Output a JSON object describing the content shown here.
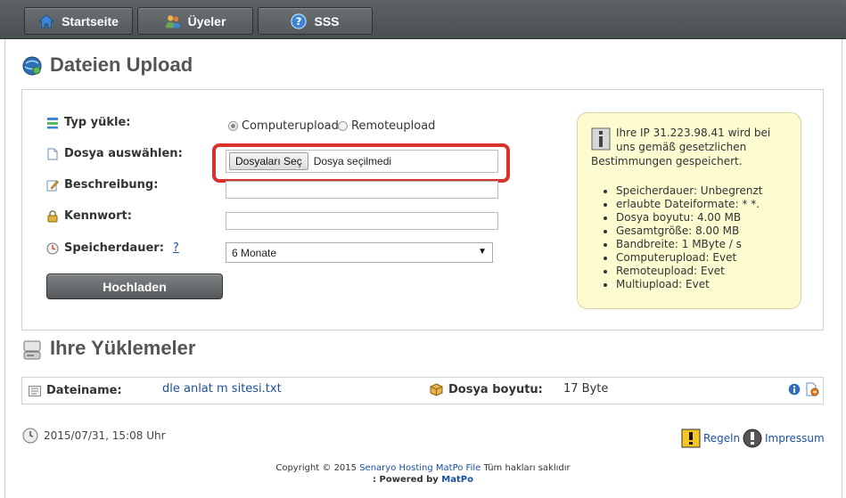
{
  "nav": {
    "items": [
      {
        "label": "Startseite",
        "icon": "home-icon"
      },
      {
        "label": "Üyeler",
        "icon": "users-icon"
      },
      {
        "label": "SSS",
        "icon": "help-icon"
      }
    ]
  },
  "upload_section": {
    "title": "Dateien Upload",
    "type_label": "Typ yükle:",
    "radio_computer": "Computerupload",
    "radio_remote": "Remoteupload",
    "file_label": "Dosya auswählen:",
    "file_button": "Dosyaları Seç",
    "file_status": "Dosya seçilmedi",
    "description_label": "Beschreibung:",
    "password_label": "Kennwort:",
    "storage_label": "Speicherdauer:",
    "storage_help": "?",
    "storage_value": "6 Monate",
    "upload_button": "Hochladen"
  },
  "info": {
    "text": "Ihre IP 31.223.98.41 wird bei uns gemäß gesetzlichen Bestimmungen gespeichert.",
    "items": [
      "Speicherdauer: Unbegrenzt",
      "erlaubte Dateiformate: * *.",
      "Dosya boyutu: 4.00 MB",
      "Gesamtgröße: 8.00 MB",
      "Bandbreite: 1 MByte / s",
      "Computerupload: Evet",
      "Remoteupload: Evet",
      "Multiupload: Evet"
    ]
  },
  "uploads_section": {
    "title": "Ihre Yüklemeler",
    "filename_label": "Dateiname:",
    "filename_value": "dle anlat m sitesi.txt",
    "size_label": "Dosya boyutu:",
    "size_value": "17 Byte"
  },
  "footer": {
    "datetime": "2015/07/31, 15:08 Uhr",
    "rules_link": "Regeln",
    "imprint_link": "Impressum",
    "copyright_prefix": "Copyright © 2015",
    "copyright_link": "Senaryo Hosting MatPo File",
    "copyright_suffix": "Tüm hakları saklıdır",
    "powered_prefix": ": Powered by",
    "powered_link": "MatPo"
  },
  "colors": {
    "highlight": "#d9312b",
    "link": "#1a4f9c",
    "info_bg": "#fdfbd0"
  }
}
